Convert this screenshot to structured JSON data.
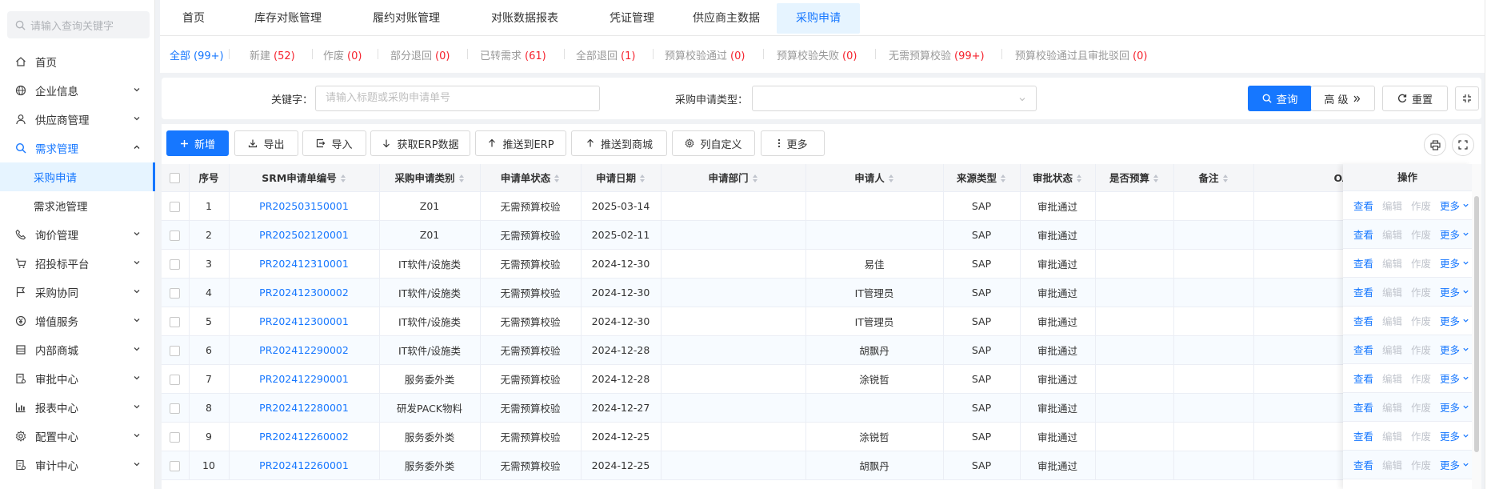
{
  "sidebar": {
    "search_placeholder": "请输入查询关键字",
    "items": [
      {
        "label": "首页",
        "icon": "home-icon",
        "chevron": false
      },
      {
        "label": "企业信息",
        "icon": "globe-icon",
        "chevron": true
      },
      {
        "label": "供应商管理",
        "icon": "user-icon",
        "chevron": true
      },
      {
        "label": "需求管理",
        "icon": "search-icon",
        "chevron": true,
        "expanded": true
      },
      {
        "label": "询价管理",
        "icon": "phone-icon",
        "chevron": true
      },
      {
        "label": "招投标平台",
        "icon": "cart-icon",
        "chevron": true
      },
      {
        "label": "采购协同",
        "icon": "flag-icon",
        "chevron": true
      },
      {
        "label": "增值服务",
        "icon": "yen-icon",
        "chevron": true
      },
      {
        "label": "内部商城",
        "icon": "store-icon",
        "chevron": true
      },
      {
        "label": "审批中心",
        "icon": "audit-icon",
        "chevron": true
      },
      {
        "label": "报表中心",
        "icon": "chart-icon",
        "chevron": true
      },
      {
        "label": "配置中心",
        "icon": "gear-icon",
        "chevron": true
      },
      {
        "label": "审计中心",
        "icon": "audit-doc-icon",
        "chevron": true
      }
    ],
    "sub_items": [
      "采购申请",
      "需求池管理"
    ]
  },
  "topnav": {
    "tabs": [
      "首页",
      "库存对账管理",
      "履约对账管理",
      "对账数据报表",
      "凭证管理",
      "供应商主数据",
      "采购申请"
    ]
  },
  "status_filters": [
    {
      "label": "全部",
      "count": "(99+)"
    },
    {
      "label": "新建",
      "count": "(52)"
    },
    {
      "label": "作废",
      "count": "(0)"
    },
    {
      "label": "部分退回",
      "count": "(0)"
    },
    {
      "label": "已转需求",
      "count": "(61)"
    },
    {
      "label": "全部退回",
      "count": "(1)"
    },
    {
      "label": "预算校验通过",
      "count": "(0)"
    },
    {
      "label": "预算校验失败",
      "count": "(0)"
    },
    {
      "label": "无需预算校验",
      "count": "(99+)"
    },
    {
      "label": "预算校验通过且审批驳回",
      "count": "(0)"
    }
  ],
  "query": {
    "keyword_label": "关键字：",
    "keyword_placeholder": "请输入标题或采购申请单号",
    "type_label": "采购申请类型：",
    "type_value": "",
    "search_label": "查询",
    "advanced_label": "高 级",
    "reset_label": "重置"
  },
  "toolbar": {
    "buttons": [
      "新增",
      "导出",
      "导入",
      "获取ERP数据",
      "推送到ERP",
      "推送到商城",
      "列自定义",
      "更多"
    ]
  },
  "table": {
    "columns": [
      "序号",
      "SRM申请单编号",
      "采购申请类别",
      "申请单状态",
      "申请日期",
      "申请部门",
      "申请人",
      "来源类型",
      "审批状态",
      "是否预算",
      "备注",
      "OA采购"
    ],
    "op_header": "操作",
    "ops": {
      "view": "查看",
      "edit": "编辑",
      "void": "作废",
      "more": "更多"
    },
    "rows": [
      [
        "1",
        "PR202503150001",
        "Z01",
        "无需预算校验",
        "2025-03-14",
        "",
        "",
        "SAP",
        "审批通过",
        "",
        "",
        ""
      ],
      [
        "2",
        "PR202502120001",
        "Z01",
        "无需预算校验",
        "2025-02-11",
        "",
        "",
        "SAP",
        "审批通过",
        "",
        "",
        ""
      ],
      [
        "3",
        "PR202412310001",
        "IT软件/设施类",
        "无需预算校验",
        "2024-12-30",
        "",
        "易佳",
        "SAP",
        "审批通过",
        "",
        "",
        ""
      ],
      [
        "4",
        "PR202412300002",
        "IT软件/设施类",
        "无需预算校验",
        "2024-12-30",
        "",
        "IT管理员",
        "SAP",
        "审批通过",
        "",
        "",
        ""
      ],
      [
        "5",
        "PR202412300001",
        "IT软件/设施类",
        "无需预算校验",
        "2024-12-30",
        "",
        "IT管理员",
        "SAP",
        "审批通过",
        "",
        "",
        ""
      ],
      [
        "6",
        "PR202412290002",
        "IT软件/设施类",
        "无需预算校验",
        "2024-12-28",
        "",
        "胡飘丹",
        "SAP",
        "审批通过",
        "",
        "",
        ""
      ],
      [
        "7",
        "PR202412290001",
        "服务委外类",
        "无需预算校验",
        "2024-12-28",
        "",
        "涂锐哲",
        "SAP",
        "审批通过",
        "",
        "",
        ""
      ],
      [
        "8",
        "PR202412280001",
        "研发PACK物料",
        "无需预算校验",
        "2024-12-27",
        "",
        "",
        "SAP",
        "审批通过",
        "",
        "",
        ""
      ],
      [
        "9",
        "PR202412260002",
        "服务委外类",
        "无需预算校验",
        "2024-12-25",
        "",
        "涂锐哲",
        "SAP",
        "审批通过",
        "",
        "",
        ""
      ],
      [
        "10",
        "PR202412260001",
        "服务委外类",
        "无需预算校验",
        "2024-12-25",
        "",
        "胡飘丹",
        "SAP",
        "审批通过",
        "",
        "",
        ""
      ]
    ]
  },
  "colors": {
    "accent": "#1677ff",
    "count_red": "#f5222d",
    "row_alt": "#f7fbff"
  }
}
